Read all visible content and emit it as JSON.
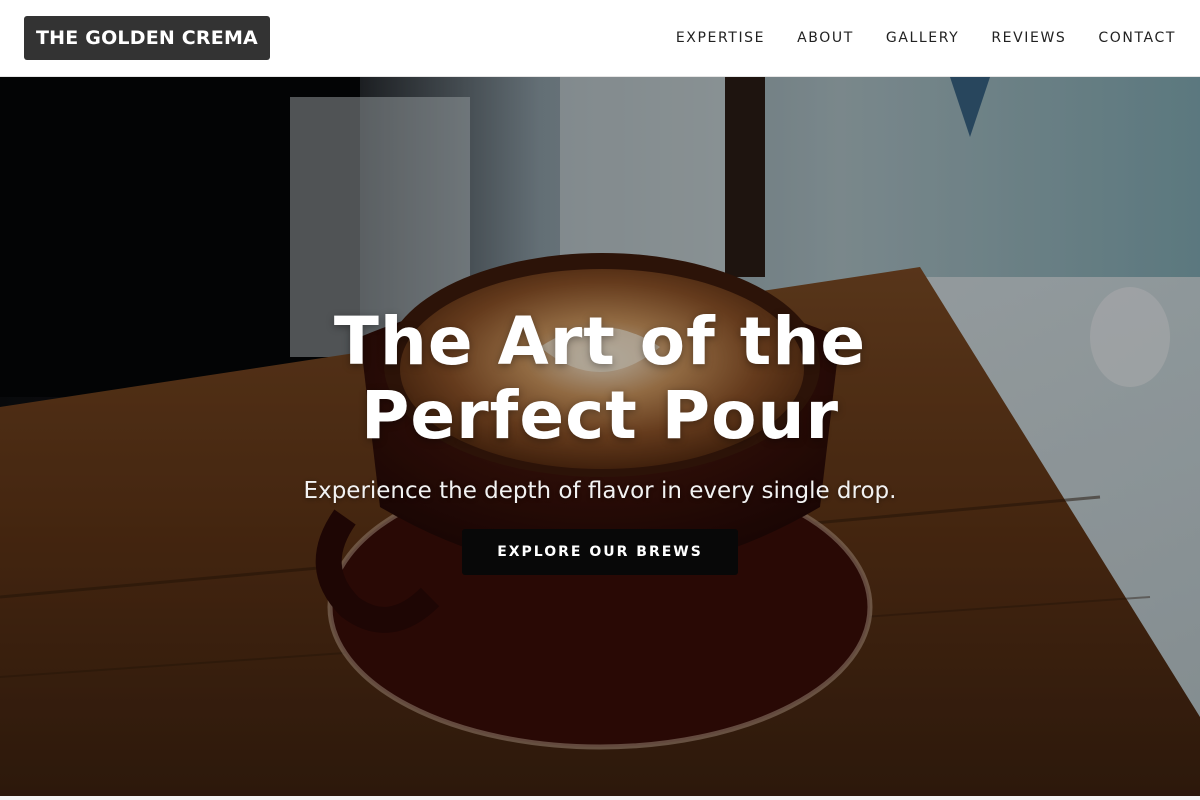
{
  "brand": {
    "name": "THE GOLDEN CREMA"
  },
  "nav": {
    "links": [
      {
        "label": "EXPERTISE"
      },
      {
        "label": "ABOUT"
      },
      {
        "label": "GALLERY"
      },
      {
        "label": "REVIEWS"
      },
      {
        "label": "CONTACT"
      }
    ]
  },
  "hero": {
    "title_line1": "The Art of the",
    "title_line2": "Perfect Pour",
    "subtitle": "Experience the depth of flavor in every single drop.",
    "cta_label": "EXPLORE OUR BREWS",
    "image_subject": "latte-art-coffee-cup-on-wooden-table"
  },
  "colors": {
    "logo_bg": "#333333",
    "nav_text": "#222222",
    "cta_bg": "#080808",
    "hero_text": "#ffffff"
  }
}
